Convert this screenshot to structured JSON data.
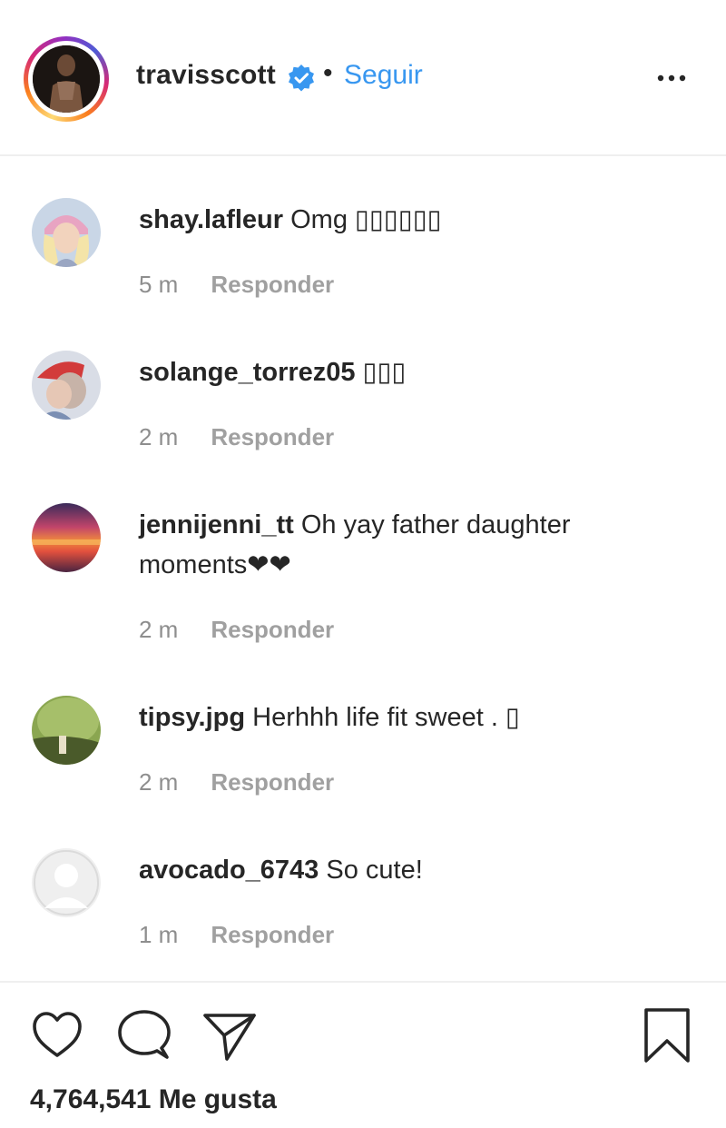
{
  "header": {
    "username": "travisscott",
    "separator": "•",
    "follow_label": "Seguir",
    "verified_icon": "verified-badge-icon",
    "more_icon": "more-options-icon",
    "verified_color": "#3897f0",
    "follow_color": "#3897f0"
  },
  "comments": [
    {
      "username": "shay.lafleur",
      "text": "Omg ▯▯▯▯▯▯",
      "time": "5 m",
      "reply_label": "Responder"
    },
    {
      "username": "solange_torrez05",
      "text": "▯▯▯",
      "time": "2 m",
      "reply_label": "Responder"
    },
    {
      "username": "jennijenni_tt",
      "text": "Oh yay father daughter moments❤❤",
      "time": "2 m",
      "reply_label": "Responder"
    },
    {
      "username": "tipsy.jpg",
      "text": "Herhhh life fit sweet . ▯",
      "time": "2 m",
      "reply_label": "Responder"
    },
    {
      "username": "avocado_6743",
      "text": "So cute!",
      "time": "1 m",
      "reply_label": "Responder"
    }
  ],
  "footer": {
    "like_icon": "heart-icon",
    "comment_icon": "comment-icon",
    "share_icon": "share-icon",
    "save_icon": "bookmark-icon",
    "likes_text": "4,764,541 Me gusta"
  }
}
